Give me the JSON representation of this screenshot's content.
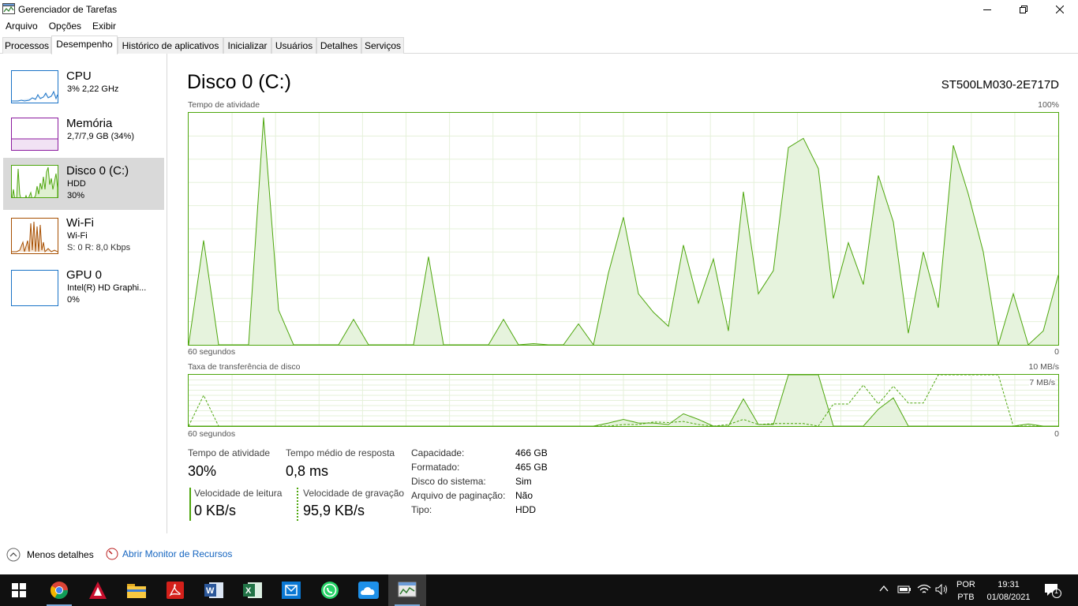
{
  "window": {
    "title": "Gerenciador de Tarefas"
  },
  "menu": [
    "Arquivo",
    "Opções",
    "Exibir"
  ],
  "tabs": [
    "Processos",
    "Desempenho",
    "Histórico de aplicativos",
    "Inicializar",
    "Usuários",
    "Detalhes",
    "Serviços"
  ],
  "active_tab": "Desempenho",
  "sidebar": {
    "items": [
      {
        "name": "CPU",
        "line1": "3% 2,22 GHz",
        "line2": "",
        "color": "#1a73c7"
      },
      {
        "name": "Memória",
        "line1": "2,7/7,9 GB (34%)",
        "line2": "",
        "color": "#8b1a9e"
      },
      {
        "name": "Disco 0 (C:)",
        "line1": "HDD",
        "line2": "30%",
        "color": "#4da60c"
      },
      {
        "name": "Wi-Fi",
        "line1": "Wi-Fi",
        "line2": "S: 0 R: 8,0 Kbps",
        "color": "#a74f01"
      },
      {
        "name": "GPU 0",
        "line1": "Intel(R) HD Graphi...",
        "line2": "0%",
        "color": "#1a73c7"
      }
    ],
    "selected": "Disco 0 (C:)"
  },
  "detail": {
    "title": "Disco 0 (C:)",
    "model": "ST500LM030-2E717D",
    "activity_label": "Tempo de atividade",
    "activity_max": "100%",
    "activity_xleft": "60 segundos",
    "activity_xright": "0",
    "transfer_label": "Taxa de transferência de disco",
    "transfer_max": "10 MB/s",
    "transfer_secondary": "7 MB/s",
    "transfer_xleft": "60 segundos",
    "transfer_xright": "0",
    "stats": {
      "active_time_label": "Tempo de atividade",
      "active_time_value": "30%",
      "response_label": "Tempo médio de resposta",
      "response_value": "0,8 ms",
      "read_label": "Velocidade de leitura",
      "read_value": "0 KB/s",
      "write_label": "Velocidade de gravação",
      "write_value": "95,9 KB/s"
    },
    "properties": [
      {
        "label": "Capacidade:",
        "value": "466 GB"
      },
      {
        "label": "Formatado:",
        "value": "465 GB"
      },
      {
        "label": "Disco do sistema:",
        "value": "Sim"
      },
      {
        "label": "Arquivo de paginação:",
        "value": "Não"
      },
      {
        "label": "Tipo:",
        "value": "HDD"
      }
    ]
  },
  "chart_data": [
    {
      "type": "area",
      "title": "Tempo de atividade",
      "ylim": [
        0,
        100
      ],
      "xlabel": "60 segundos",
      "values": [
        0,
        45,
        0,
        0,
        0,
        98,
        15,
        0,
        0,
        0,
        0,
        11,
        0,
        0,
        0,
        0,
        38,
        0,
        0,
        0,
        0,
        11,
        0,
        0.5,
        0,
        0,
        9,
        0,
        31,
        55,
        22,
        14,
        8,
        43,
        18,
        37,
        6,
        66,
        22,
        32,
        85,
        89,
        76,
        20,
        44,
        26,
        73,
        53,
        5,
        40,
        16,
        86,
        65,
        40,
        0,
        22,
        0,
        6,
        30
      ]
    },
    {
      "type": "area",
      "title": "Taxa de transferência de disco",
      "ylim": [
        0,
        10
      ],
      "xlabel": "60 segundos",
      "series": [
        {
          "name": "Velocidade de leitura",
          "values": [
            0,
            0,
            0,
            0,
            0,
            0,
            0,
            0,
            0,
            0,
            0,
            0,
            0,
            0,
            0,
            0,
            0,
            0,
            0,
            0,
            0,
            0,
            0,
            0,
            0,
            0,
            0,
            0,
            0.6,
            1.3,
            0.6,
            0.6,
            0.3,
            2.4,
            1.3,
            0,
            0,
            5.3,
            0.3,
            0.3,
            10,
            10,
            10,
            0,
            0,
            0,
            3.3,
            5.5,
            0,
            0,
            0,
            0,
            0,
            0,
            0,
            0,
            0.4,
            0,
            0
          ]
        },
        {
          "name": "Velocidade de gravação",
          "values": [
            0,
            6,
            0,
            0,
            0,
            0,
            0,
            0,
            0,
            0,
            0,
            0,
            0,
            0,
            0,
            0,
            0,
            0,
            0,
            0,
            0,
            0,
            0,
            0,
            0,
            0,
            0,
            0,
            0,
            0.3,
            0.3,
            0.8,
            0.7,
            0.9,
            0.3,
            0,
            0.3,
            1.3,
            0.3,
            0.5,
            0.5,
            0.5,
            0,
            4.3,
            4.3,
            8,
            4.3,
            7.8,
            4.5,
            4.5,
            10,
            10,
            10,
            10,
            10,
            0,
            0,
            0,
            0
          ]
        }
      ]
    }
  ],
  "footer": {
    "less_details": "Menos detalhes",
    "resource_monitor": "Abrir Monitor de Recursos"
  },
  "taskbar": {
    "apps": [
      "windows-start",
      "chrome",
      "autocad",
      "file-explorer",
      "acrobat",
      "word",
      "excel",
      "outlook-mail",
      "whatsapp",
      "onedrive",
      "task-manager"
    ],
    "lang1": "POR",
    "lang2": "PTB",
    "time": "19:31",
    "date": "01/08/2021",
    "notification_count": "1"
  }
}
